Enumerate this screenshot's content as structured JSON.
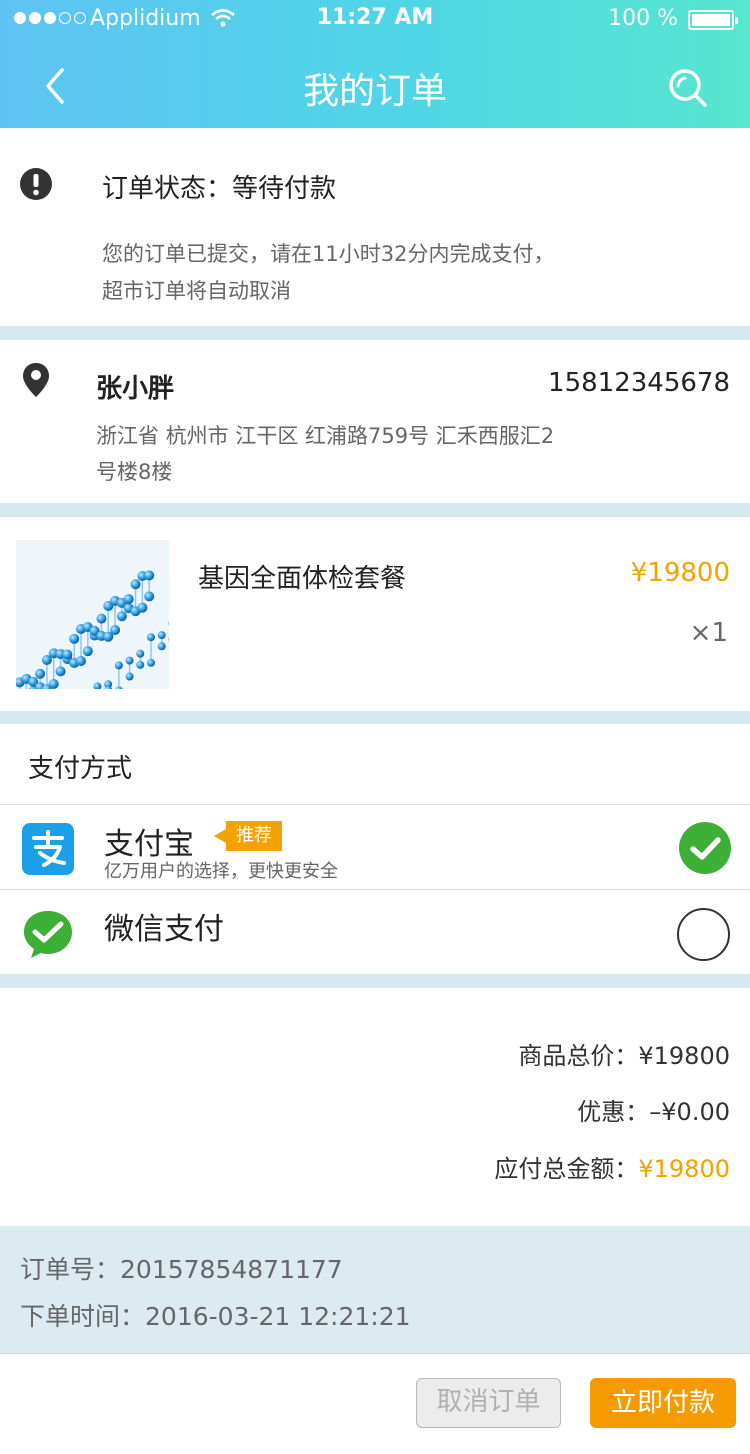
{
  "status_bar": {
    "carrier": "Applidium",
    "time": "11:27 AM",
    "battery_text": "100 %",
    "battery_level": 1.0
  },
  "header": {
    "title": "我的订单",
    "back_icon": "chevron-left-icon",
    "search_icon": "search-icon"
  },
  "order_status": {
    "label": "订单状态：等待付款",
    "note_line1": "您的订单已提交，请在11小时32分内完成支付，",
    "note_line2": "超市订单将自动取消"
  },
  "address": {
    "name": "张小胖",
    "phone": "15812345678",
    "line1": "浙江省 杭州市 江干区 红浦路759号 汇禾西服汇2",
    "line2": "号楼8楼"
  },
  "product": {
    "name": "基因全面体检套餐",
    "price": "¥19800",
    "quantity": "×1"
  },
  "payment": {
    "title": "支付方式",
    "options": [
      {
        "name": "支付宝",
        "badge": "推荐",
        "desc": "亿万用户的选择，更快更安全",
        "selected": true,
        "icon": "alipay-icon"
      },
      {
        "name": "微信支付",
        "selected": false,
        "icon": "wechat-pay-icon"
      }
    ]
  },
  "totals": {
    "subtotal_label": "商品总价：",
    "subtotal_value": "¥19800",
    "discount_label": "优惠：",
    "discount_value": "–¥0.00",
    "due_label": "应付总金额：",
    "due_value": "¥19800"
  },
  "order_info": {
    "number_label": "订单号：",
    "number": "20157854871177",
    "time_label": "下单时间：",
    "time": "2016-03-21 12:21:21"
  },
  "actions": {
    "cancel_label": "取消订单",
    "pay_label": "立即付款"
  },
  "colors": {
    "accent_orange": "#f5a100",
    "header_gradient_start": "#5ec3f4",
    "header_gradient_end": "#57e6cf",
    "alipay_blue": "#1a9fe8",
    "check_green": "#3dae36"
  }
}
